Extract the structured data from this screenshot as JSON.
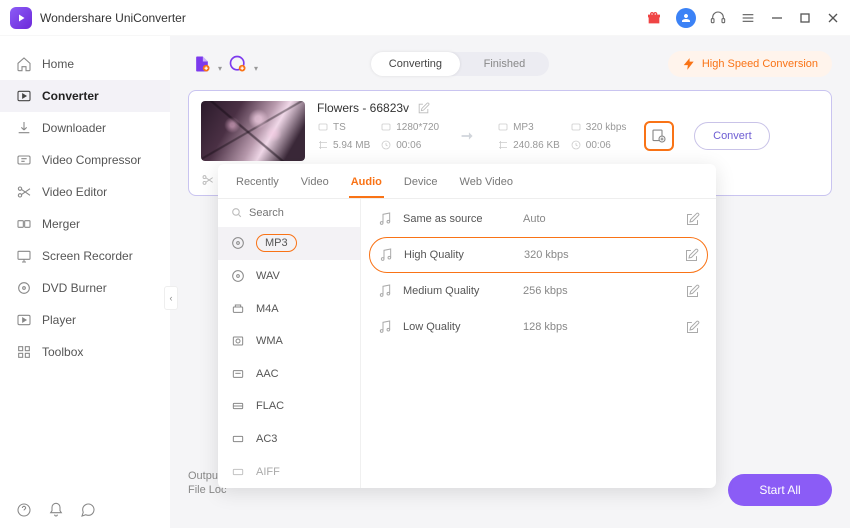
{
  "app": {
    "title": "Wondershare UniConverter"
  },
  "sidebar": {
    "items": [
      {
        "label": "Home"
      },
      {
        "label": "Converter"
      },
      {
        "label": "Downloader"
      },
      {
        "label": "Video Compressor"
      },
      {
        "label": "Video Editor"
      },
      {
        "label": "Merger"
      },
      {
        "label": "Screen Recorder"
      },
      {
        "label": "DVD Burner"
      },
      {
        "label": "Player"
      },
      {
        "label": "Toolbox"
      }
    ]
  },
  "header": {
    "seg": {
      "converting": "Converting",
      "finished": "Finished"
    },
    "hsc": "High Speed Conversion"
  },
  "file": {
    "name": "Flowers - 66823v",
    "src": {
      "format": "TS",
      "res": "1280*720",
      "size": "5.94 MB",
      "dur": "00:06"
    },
    "dst": {
      "format": "MP3",
      "rate": "320 kbps",
      "size": "240.86 KB",
      "dur": "00:06"
    },
    "convert": "Convert"
  },
  "footer": {
    "output": "Output",
    "fileloc": "File Loc",
    "start_all": "Start All"
  },
  "popover": {
    "tabs": {
      "recently": "Recently",
      "video": "Video",
      "audio": "Audio",
      "device": "Device",
      "webvideo": "Web Video"
    },
    "search_placeholder": "Search",
    "formats": [
      "MP3",
      "WAV",
      "M4A",
      "WMA",
      "AAC",
      "FLAC",
      "AC3",
      "AIFF"
    ],
    "qualities": [
      {
        "name": "Same as source",
        "rate": "Auto"
      },
      {
        "name": "High Quality",
        "rate": "320 kbps"
      },
      {
        "name": "Medium Quality",
        "rate": "256 kbps"
      },
      {
        "name": "Low Quality",
        "rate": "128 kbps"
      }
    ]
  }
}
